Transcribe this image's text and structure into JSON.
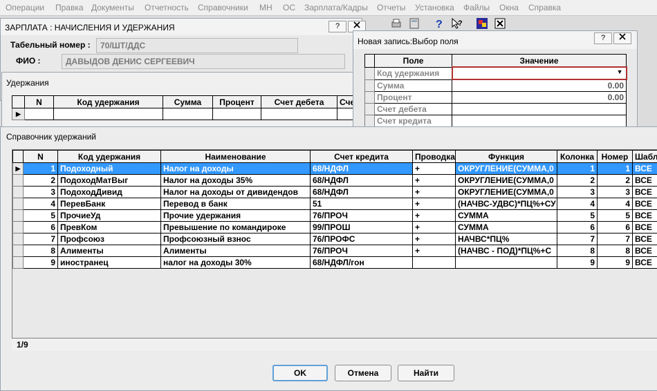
{
  "menu": [
    "Операции",
    "Правка",
    "Документы",
    "Отчетность",
    "Справочники",
    "МН",
    "ОС",
    "Зарплата/Кадры",
    "Отчеты",
    "Установка",
    "Файлы",
    "Окна",
    "Справка"
  ],
  "main_window": {
    "title": "ЗАРПЛАТА : НАЧИСЛЕНИЯ И УДЕРЖАНИЯ",
    "help_btn": "?",
    "tab_num_label": "Табельный номер :",
    "tab_num_value": "70/ШТ/ДДС",
    "fio_label": "ФИО :",
    "fio_value": "ДАВЫДОВ ДЕНИС СЕРГЕЕВИЧ"
  },
  "deductions_window": {
    "title": "Удержания",
    "columns": [
      "N",
      "Код удержания",
      "Сумма",
      "Процент",
      "Счет дебета",
      "Сче"
    ]
  },
  "field_dialog": {
    "title": "Новая запись:Выбор поля",
    "help_btn": "?",
    "columns": [
      "Поле",
      "Значение"
    ],
    "rows": [
      {
        "field": "Код удержания",
        "value": ""
      },
      {
        "field": "Сумма",
        "value": "0.00"
      },
      {
        "field": "Процент",
        "value": "0.00"
      },
      {
        "field": "Счет дебета",
        "value": ""
      },
      {
        "field": "Счет кредита",
        "value": ""
      }
    ]
  },
  "reference": {
    "title": "Справочник удержаний",
    "columns": [
      "N",
      "Код удержания",
      "Наименование",
      "Счет кредита",
      "Проводка",
      "Функция",
      "Колонка",
      "Номер",
      "Шаблон"
    ],
    "rows": [
      [
        "1",
        "Подоходный",
        "Налог на доходы",
        "68/НДФЛ",
        "+",
        "ОКРУГЛЕНИЕ(СУММА,0",
        "1",
        "1",
        "ВСЕ"
      ],
      [
        "2",
        "ПодоходМатВыг",
        "Налог на доходы 35%",
        "68/НДФЛ",
        "+",
        "ОКРУГЛЕНИЕ(СУММА,0",
        "2",
        "2",
        "ВСЕ"
      ],
      [
        "3",
        "ПодоходДивид",
        "Налог на доходы от дивидендов",
        "68/НДФЛ",
        "+",
        "ОКРУГЛЕНИЕ(СУММА,0",
        "3",
        "3",
        "ВСЕ"
      ],
      [
        "4",
        "ПеревБанк",
        "Перевод в банк",
        "51",
        "+",
        "(НАЧВС-УДВС)*ПЦ%+СУ",
        "4",
        "4",
        "ВСЕ"
      ],
      [
        "5",
        "ПрочиеУд",
        "Прочие удержания",
        "76/ПРОЧ",
        "+",
        "СУММА",
        "5",
        "5",
        "ВСЕ"
      ],
      [
        "6",
        "ПревКом",
        "Превышение по командироке",
        "99/ПРОШ",
        "+",
        "СУММА",
        "6",
        "6",
        "ВСЕ"
      ],
      [
        "7",
        "Профсоюз",
        "Профсоюзный взнос",
        "76/ПРОФС",
        "+",
        "НАЧВС*ПЦ%",
        "7",
        "7",
        "ВСЕ"
      ],
      [
        "8",
        "Алименты",
        "Алименты",
        "76/ПРОЧ",
        "+",
        "(НАЧВС - ПОД)*ПЦ%+С",
        "8",
        "8",
        "ВСЕ"
      ],
      [
        "9",
        "иностранец",
        "налог на доходы 30%",
        "68/НДФЛ/гон",
        "",
        "",
        "9",
        "9",
        "ВСЕ"
      ]
    ],
    "status": "1/9"
  },
  "buttons": {
    "ok": "OK",
    "cancel": "Отмена",
    "find": "Найти"
  }
}
